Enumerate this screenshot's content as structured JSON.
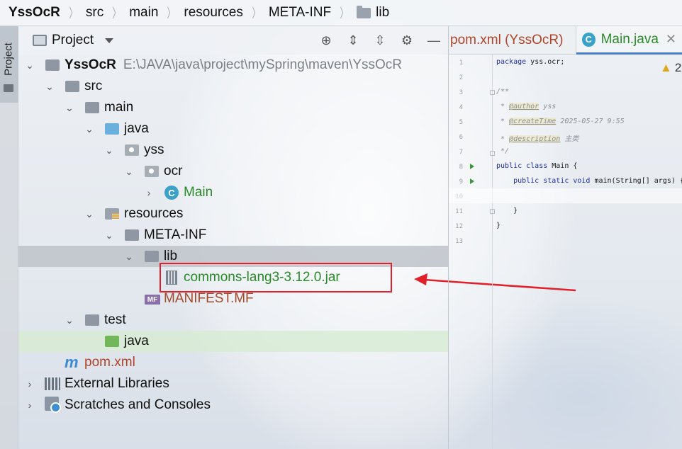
{
  "breadcrumb": [
    "YssOcR",
    "src",
    "main",
    "resources",
    "META-INF",
    "lib"
  ],
  "side_tab": {
    "label": "Project"
  },
  "project_panel": {
    "title": "Project",
    "tools": [
      "target-icon",
      "expand-all-icon",
      "collapse-all-icon",
      "gear-icon",
      "minimize-icon"
    ]
  },
  "tree": [
    {
      "label": "YssOcR",
      "path": "E:\\JAVA\\java\\project\\mySpring\\maven\\YssOcR",
      "icon": "module-folder-icon"
    },
    {
      "label": "src",
      "icon": "folder-icon"
    },
    {
      "label": "main",
      "icon": "folder-icon"
    },
    {
      "label": "java",
      "icon": "source-folder-icon"
    },
    {
      "label": "yss",
      "icon": "package-icon"
    },
    {
      "label": "ocr",
      "icon": "package-icon"
    },
    {
      "label": "Main",
      "icon": "class-icon"
    },
    {
      "label": "resources",
      "icon": "resources-folder-icon"
    },
    {
      "label": "META-INF",
      "icon": "folder-icon"
    },
    {
      "label": "lib",
      "icon": "folder-icon"
    },
    {
      "label": "commons-lang3-3.12.0.jar",
      "icon": "jar-icon"
    },
    {
      "label": "MANIFEST.MF",
      "icon": "manifest-icon",
      "icon_text": "MF"
    },
    {
      "label": "test",
      "icon": "folder-icon"
    },
    {
      "label": "java",
      "icon": "test-folder-icon"
    },
    {
      "label": "pom.xml",
      "icon": "maven-icon",
      "icon_text": "m"
    },
    {
      "label": "External Libraries",
      "icon": "libraries-icon"
    },
    {
      "label": "Scratches and Consoles",
      "icon": "scratches-icon"
    }
  ],
  "editor": {
    "tabs": [
      {
        "label": "pom.xml (YssOcR)"
      },
      {
        "label": "Main.java",
        "active": true
      }
    ],
    "warning_count": "2",
    "line_numbers": [
      "1",
      "2",
      "3",
      "4",
      "5",
      "6",
      "7",
      "8",
      "9",
      "10",
      "11",
      "12",
      "13"
    ],
    "code": {
      "l1_kw": "package",
      "l1_rest": " yss.ocr;",
      "l3": "/**",
      "l4_pre": " * ",
      "l4_tag": "@author",
      "l4_val": " yss",
      "l5_pre": " * ",
      "l5_tag": "@createTime",
      "l5_val": " 2025-05-27 9:55",
      "l6_pre": " * ",
      "l6_tag": "@description",
      "l6_val": " 主类",
      "l7": " */",
      "l8_kw": "public class",
      "l8_rest": " Main {",
      "l9_kw": "    public static void",
      "l9_rest": " main(String[] args) {",
      "l11": "    }",
      "l12": "}"
    }
  },
  "colors": {
    "annotation_red": "#e2202b",
    "green_file": "#2a8a2a",
    "brown_file": "#b0442a",
    "keyword": "#1f2fa0"
  }
}
